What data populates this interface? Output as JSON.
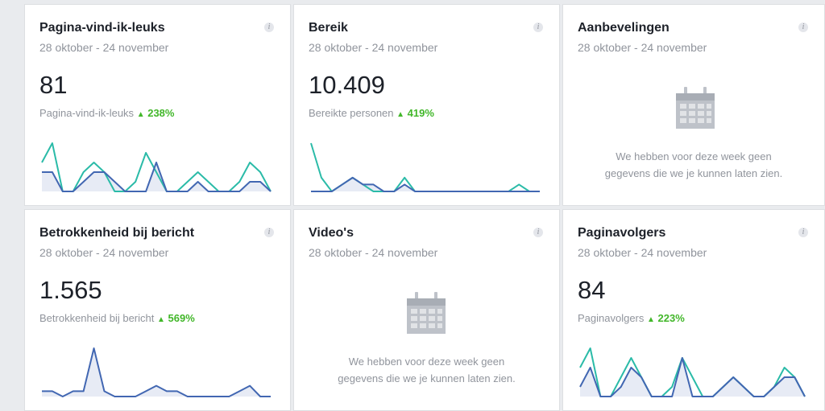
{
  "cards": [
    {
      "title": "Pagina-vind-ik-leuks",
      "date": "28 oktober - 24 november",
      "value": "81",
      "label": "Pagina-vind-ik-leuks",
      "delta": "238%"
    },
    {
      "title": "Bereik",
      "date": "28 oktober - 24 november",
      "value": "10.409",
      "label": "Bereikte personen",
      "delta": "419%"
    },
    {
      "title": "Aanbevelingen",
      "date": "28 oktober - 24 november",
      "empty_line1": "We hebben voor deze week geen",
      "empty_line2": "gegevens die we je kunnen laten zien."
    },
    {
      "title": "Betrokkenheid bij bericht",
      "date": "28 oktober - 24 november",
      "value": "1.565",
      "label": "Betrokkenheid bij bericht",
      "delta": "569%"
    },
    {
      "title": "Video's",
      "date": "28 oktober - 24 november",
      "empty_line1": "We hebben voor deze week geen",
      "empty_line2": "gegevens die we je kunnen laten zien."
    },
    {
      "title": "Paginavolgers",
      "date": "28 oktober - 24 november",
      "value": "84",
      "label": "Paginavolgers",
      "delta": "223%"
    }
  ],
  "info_glyph": "i",
  "delta_glyph": "▲",
  "colors": {
    "teal": "#2bbba8",
    "blue": "#4267b2",
    "fill": "#e7ebf5",
    "up": "#42b72a"
  },
  "sparklines": {
    "card0": {
      "blue": [
        2,
        2,
        0,
        0,
        1,
        2,
        2,
        1,
        0,
        0,
        0,
        3,
        0,
        0,
        0,
        1,
        0,
        0,
        0,
        0,
        1,
        1,
        0
      ],
      "teal": [
        3,
        5,
        0,
        0,
        2,
        3,
        2,
        0,
        0,
        1,
        4,
        2,
        0,
        0,
        1,
        2,
        1,
        0,
        0,
        1,
        3,
        2,
        0
      ]
    },
    "card1": {
      "blue": [
        0,
        0,
        0,
        1,
        2,
        1,
        1,
        0,
        0,
        1,
        0,
        0,
        0,
        0,
        0,
        0,
        0,
        0,
        0,
        0,
        0,
        0,
        0
      ],
      "teal": [
        7,
        2,
        0,
        1,
        2,
        1,
        0,
        0,
        0,
        2,
        0,
        0,
        0,
        0,
        0,
        0,
        0,
        0,
        0,
        0,
        1,
        0,
        0
      ]
    },
    "card3": {
      "blue": [
        1,
        1,
        0,
        1,
        1,
        9,
        1,
        0,
        0,
        0,
        1,
        2,
        1,
        1,
        0,
        0,
        0,
        0,
        0,
        1,
        2,
        0,
        0
      ]
    },
    "card5": {
      "blue": [
        1,
        3,
        0,
        0,
        1,
        3,
        2,
        0,
        0,
        0,
        4,
        0,
        0,
        0,
        1,
        2,
        1,
        0,
        0,
        1,
        2,
        2,
        0
      ],
      "teal": [
        3,
        5,
        0,
        0,
        2,
        4,
        2,
        0,
        0,
        1,
        4,
        2,
        0,
        0,
        1,
        2,
        1,
        0,
        0,
        1,
        3,
        2,
        0
      ]
    }
  }
}
